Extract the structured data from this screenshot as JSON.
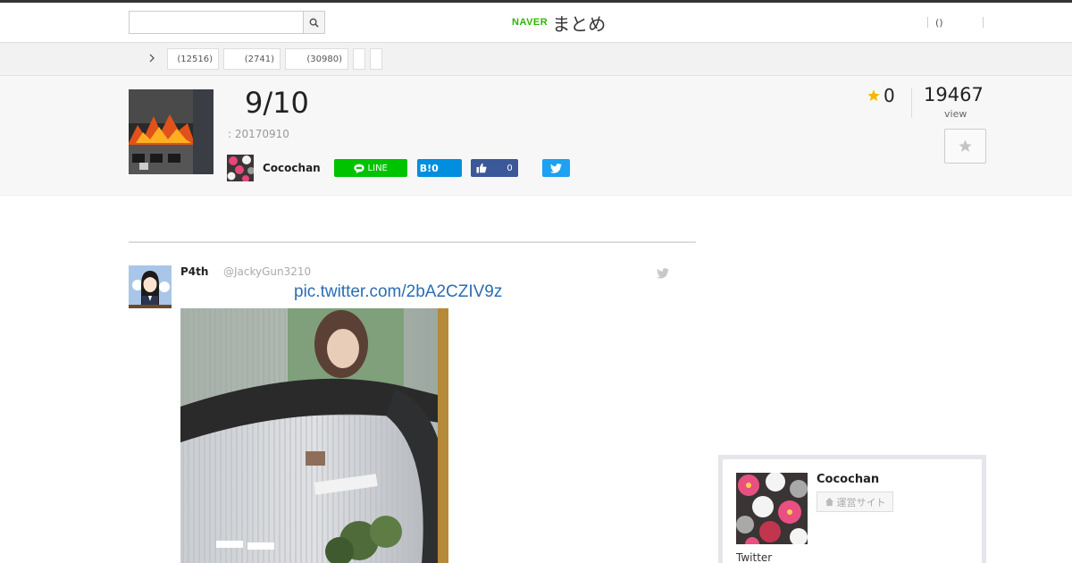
{
  "header": {
    "search_placeholder": "",
    "logo_naver": "NAVER",
    "logo_matome": "まとめ",
    "user_link": "()"
  },
  "breadcrumb": {
    "home": "",
    "categories": [
      {
        "label": "(12516)"
      },
      {
        "label": "(2741)"
      },
      {
        "label": "(30980)"
      },
      {
        "label": ""
      },
      {
        "label": ""
      }
    ]
  },
  "article": {
    "title": "9/10",
    "date": ": 20170910",
    "author": "Cocochan",
    "share": {
      "line": "LINE",
      "hatena": "B!",
      "hatena_count": "0",
      "like_count": "0"
    },
    "favorite_count": "0",
    "view_count": "19467",
    "view_label": "view"
  },
  "tweet": {
    "name": "P4th",
    "handle": "@JackyGun3210",
    "link": "pic.twitter.com/2bA2CZIV9z"
  },
  "sidebar": {
    "author_name": "Cocochan",
    "site_button": "運営サイト",
    "twitter_label": "Twitter"
  },
  "colors": {
    "brand_green": "#2db400",
    "line_green": "#00c300",
    "hatena_blue": "#008fde",
    "facebook_blue": "#3b5998",
    "twitter_blue": "#1da1f2",
    "link_blue": "#2b6db3",
    "star_yellow": "#f5b800"
  },
  "icons": [
    "search-icon",
    "chevron-right-icon",
    "line-icon",
    "thumbs-up-icon",
    "twitter-bird-icon",
    "star-icon",
    "home-icon"
  ]
}
